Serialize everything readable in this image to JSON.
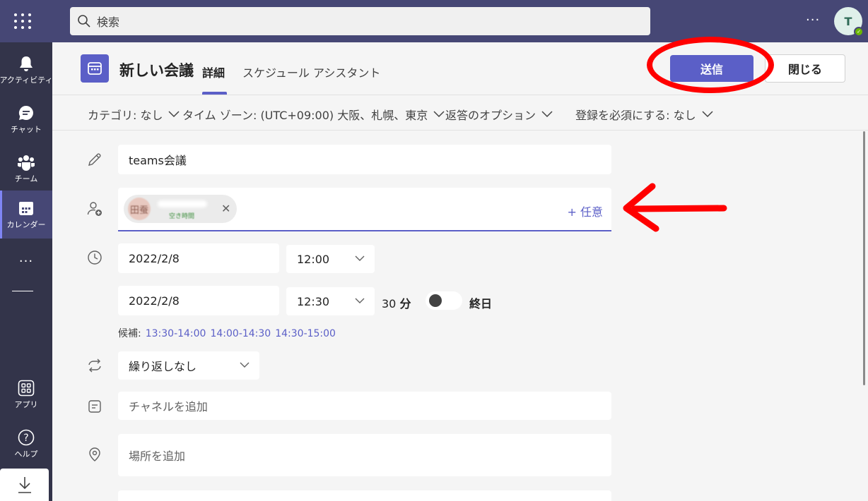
{
  "topbar": {
    "search_placeholder": "検索",
    "more": "···",
    "avatar_initial": "T"
  },
  "rail": {
    "items": [
      {
        "label": "アクティビティ",
        "icon": "bell-icon"
      },
      {
        "label": "チャット",
        "icon": "chat-icon"
      },
      {
        "label": "チーム",
        "icon": "teams-icon"
      },
      {
        "label": "カレンダー",
        "icon": "calendar-icon"
      },
      {
        "label": "アプリ",
        "icon": "apps-icon"
      },
      {
        "label": "ヘルプ",
        "icon": "help-icon"
      }
    ],
    "more": "···",
    "active": "カレンダー"
  },
  "header": {
    "title": "新しい会議",
    "tab_details": "詳細",
    "tab_assistant": "スケジュール アシスタント",
    "send_label": "送信",
    "close_label": "閉じる"
  },
  "options": {
    "category": "カテゴリ: なし",
    "timezone": "タイム ゾーン: (UTC+09:00) 大阪、札幌、東京",
    "response": "返答のオプション",
    "registration": "登録を必須にする: なし"
  },
  "form": {
    "title_value": "teams会議",
    "attendee_chip": {
      "name": "田蚕",
      "status": "空き時間"
    },
    "optional_label": "+ 任意",
    "start_date": "2022/2/8",
    "start_time": "12:00",
    "end_date": "2022/2/8",
    "end_time": "12:30",
    "duration_num": "30",
    "duration_unit": "分",
    "all_day_label": "終日",
    "all_day_on": false,
    "suggestions_label": "候補:",
    "suggestions": [
      "13:30-14:00",
      "14:00-14:30",
      "14:30-15:00"
    ],
    "repeat_value": "繰り返しなし",
    "channel_placeholder": "チャネルを追加",
    "location_placeholder": "場所を追加"
  },
  "colors": {
    "brand": "#5b5fc7",
    "topbar": "#464775",
    "rail": "#33344a",
    "annotation": "#ff0000"
  }
}
